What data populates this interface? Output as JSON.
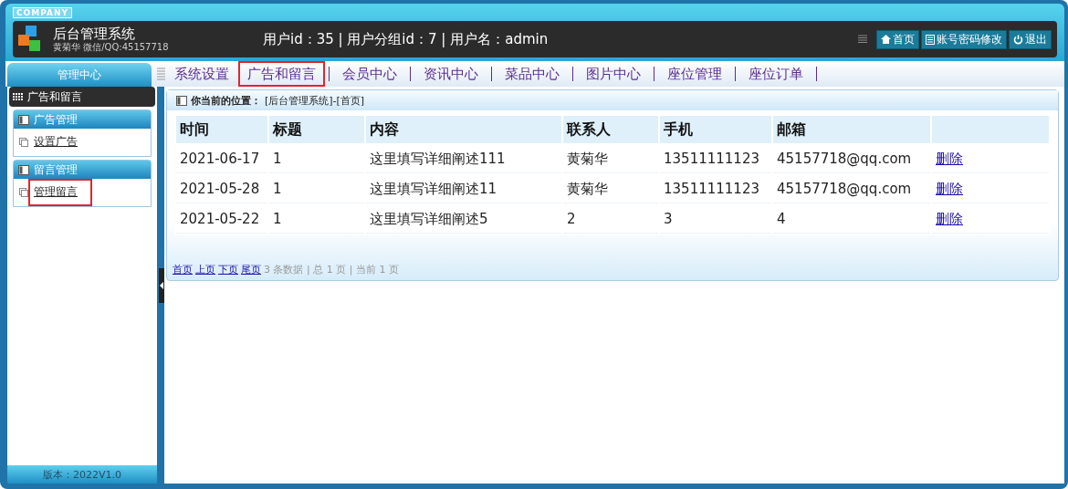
{
  "header": {
    "badge": "COMPANY",
    "title": "后台管理系统",
    "subtitle": "黄菊华 微信/QQ:45157718",
    "user_info": "用户id：35 | 用户分组id：7 | 用户名：admin",
    "buttons": [
      {
        "kind": "home",
        "label": "首页"
      },
      {
        "kind": "account",
        "label": "账号密码修改"
      },
      {
        "kind": "logout",
        "label": "退出"
      }
    ]
  },
  "sidebar": {
    "title": "管理中心",
    "section": "广告和留言",
    "groups": [
      {
        "title": "广告管理",
        "items": [
          {
            "label": "设置广告",
            "highlighted": false
          }
        ]
      },
      {
        "title": "留言管理",
        "items": [
          {
            "label": "管理留言",
            "highlighted": true
          }
        ]
      }
    ],
    "version": "版本：2022V1.0"
  },
  "nav": [
    {
      "label": "系统设置",
      "highlighted": false
    },
    {
      "label": "广告和留言",
      "highlighted": true
    },
    {
      "label": "会员中心",
      "highlighted": false
    },
    {
      "label": "资讯中心",
      "highlighted": false
    },
    {
      "label": "菜品中心",
      "highlighted": false
    },
    {
      "label": "图片中心",
      "highlighted": false
    },
    {
      "label": "座位管理",
      "highlighted": false
    },
    {
      "label": "座位订单",
      "highlighted": false
    }
  ],
  "breadcrumb": {
    "label": "你当前的位置：",
    "path": "[后台管理系统]-[首页]"
  },
  "table": {
    "columns": [
      "时间",
      "标题",
      "内容",
      "联系人",
      "手机",
      "邮箱"
    ],
    "rows": [
      {
        "cells": [
          "2021-06-17",
          "1",
          "这里填写详细阐述111",
          "黄菊华",
          "13511111123",
          "45157718@qq.com"
        ],
        "action": "删除"
      },
      {
        "cells": [
          "2021-05-28",
          "1",
          "这里填写详细阐述11",
          "黄菊华",
          "13511111123",
          "45157718@qq.com"
        ],
        "action": "删除"
      },
      {
        "cells": [
          "2021-05-22",
          "1",
          "这里填写详细阐述5",
          "2",
          "3",
          "4"
        ],
        "action": "删除"
      }
    ]
  },
  "pagination": {
    "links": [
      "首页",
      "上页",
      "下页",
      "尾页"
    ],
    "summary": "3 条数据 | 总 1 页 | 当前 1 页"
  }
}
